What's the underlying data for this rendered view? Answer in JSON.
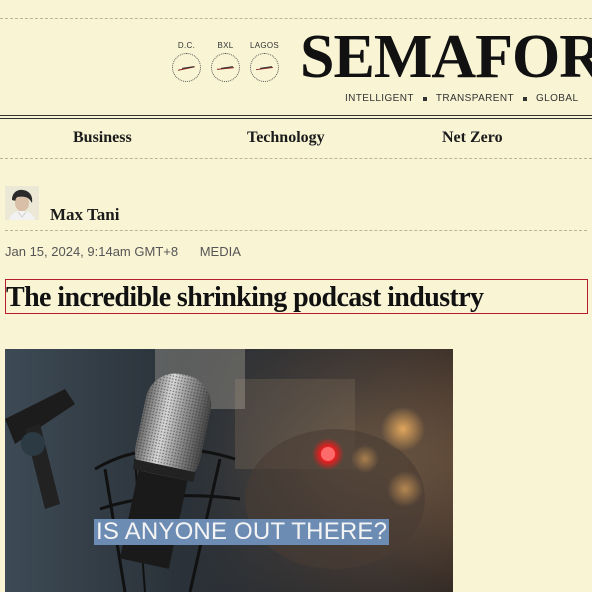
{
  "masthead": {
    "brand": "SEMAFOR",
    "clocks": [
      {
        "label": "D.C."
      },
      {
        "label": "BXL"
      },
      {
        "label": "LAGOS"
      }
    ],
    "tagline": [
      "INTELLIGENT",
      "TRANSPARENT",
      "GLOBAL"
    ]
  },
  "nav": {
    "items": [
      "Business",
      "Technology",
      "Net Zero"
    ]
  },
  "article": {
    "author": "Max Tani",
    "date": "Jan 15, 2024, 9:14am GMT+8",
    "section": "MEDIA",
    "headline": "The incredible shrinking podcast industry",
    "image_caption": "IS ANYONE OUT THERE?"
  },
  "colors": {
    "background": "#f8f4d4",
    "headline_highlight": "#b81c2a",
    "caption_bg": "#6d8cb4"
  }
}
